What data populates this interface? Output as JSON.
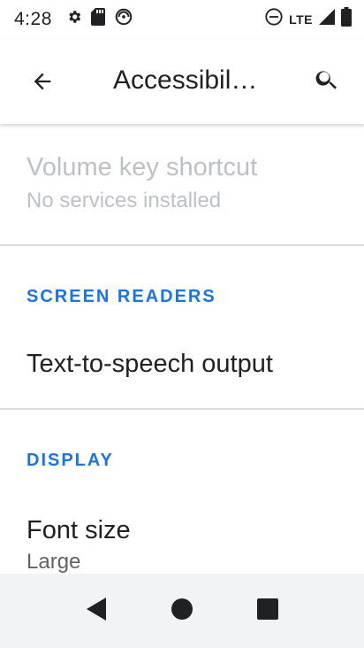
{
  "status_bar": {
    "time": "4:28",
    "network_label": "LTE",
    "icons": [
      "settings-gear-icon",
      "sd-card-icon",
      "do-not-disturb-icon",
      "minus-circle-icon",
      "signal-icon",
      "battery-icon"
    ]
  },
  "app_bar": {
    "title": "Accessibil…",
    "back_icon": "arrow-back-icon",
    "search_icon": "search-icon"
  },
  "list": {
    "volume_key": {
      "title": "Volume key shortcut",
      "summary": "No services installed",
      "enabled": false
    },
    "screen_readers_header": "SCREEN READERS",
    "tts": {
      "title": "Text-to-speech output"
    },
    "display_header": "DISPLAY",
    "font_size": {
      "title": "Font size",
      "summary": "Large"
    }
  },
  "nav_bar": {
    "back": "nav-back-icon",
    "home": "nav-home-icon",
    "recents": "nav-recents-icon"
  },
  "colors": {
    "accent": "#1a73e8",
    "text": "#202124",
    "secondary": "#5f6368",
    "disabled": "#bdc1c6",
    "nav_bg": "#f1f3f4"
  }
}
